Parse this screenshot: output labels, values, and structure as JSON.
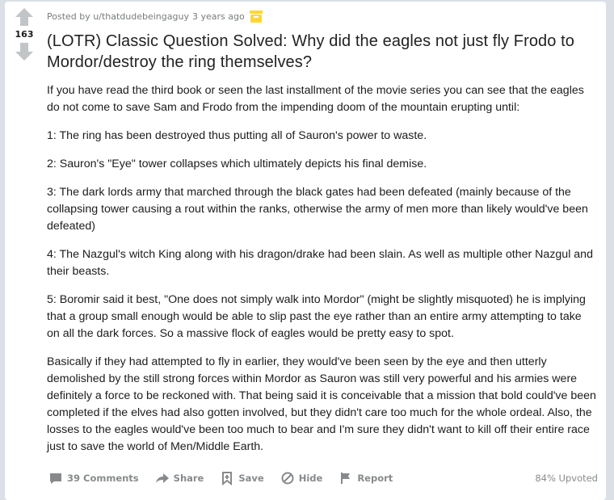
{
  "post": {
    "score": "163",
    "posted_by_prefix": "Posted by",
    "username": "u/thatdudebeingaguy",
    "age": "3 years ago",
    "title": "(LOTR) Classic Question Solved: Why did the eagles not just fly Frodo to Mordor/destroy the ring themselves?",
    "paragraphs": [
      "If you have read the third book or seen the last installment of the movie series you can see that the eagles do not come to save Sam and Frodo from the impending doom of the mountain erupting until:",
      "1: The ring has been destroyed thus putting all of Sauron's power to waste.",
      "2: Sauron's \"Eye\" tower collapses which ultimately depicts his final demise.",
      "3: The dark lords army that marched through the black gates had been defeated (mainly because of the collapsing tower causing a rout within the ranks, otherwise the army of men more than likely would've been defeated)",
      "4: The Nazgul's witch King along with his dragon/drake had been slain. As well as multiple other Nazgul and their beasts.",
      "5: Boromir said it best, \"One does not simply walk into Mordor\" (might be slightly misquoted) he is implying that a group small enough would be able to slip past the eye rather than an entire army attempting to take on all the dark forces. So a massive flock of eagles would be pretty easy to spot.",
      "Basically if they had attempted to fly in earlier, they would've been seen by the eye and then utterly demolished by the still strong forces within Mordor as Sauron was still very powerful and his armies were definitely a force to be reckoned with. That being said it is conceivable that a mission that bold could've been completed if the elves had also gotten involved, but they didn't care too much for the whole ordeal. Also, the losses to the eagles would've been too much to bear and I'm sure they didn't want to kill off their entire race just to save the world of Men/Middle Earth."
    ]
  },
  "actions": {
    "comments": "39 Comments",
    "share": "Share",
    "save": "Save",
    "hide": "Hide",
    "report": "Report",
    "upvoted": "84% Upvoted"
  },
  "icons": {
    "upvote": "arrow-up-icon",
    "downvote": "arrow-down-icon",
    "badge": "archived-box-icon",
    "comments": "comment-bubble-icon",
    "share": "share-arrow-icon",
    "save": "bookmark-plus-icon",
    "hide": "hide-circle-slash-icon",
    "report": "flag-icon"
  },
  "colors": {
    "background": "#dae0e6",
    "card": "#ffffff",
    "arrow": "#c2c5c7",
    "meta_text": "#787c7e",
    "action_text": "#878a8c",
    "badge": "#ffd635"
  }
}
